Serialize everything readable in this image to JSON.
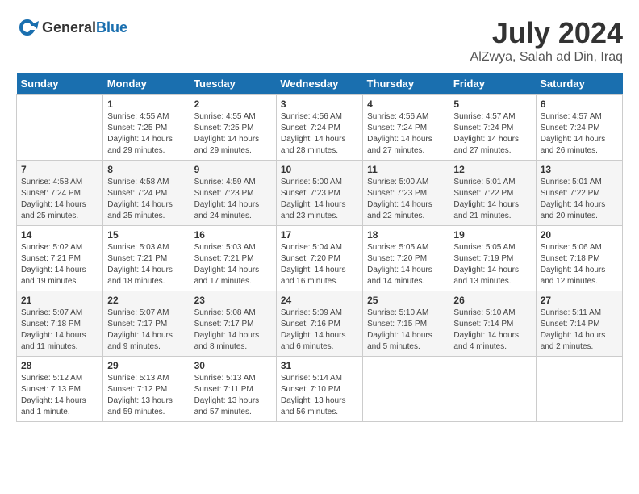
{
  "header": {
    "logo_general": "General",
    "logo_blue": "Blue",
    "title": "July 2024",
    "location": "AlZwya, Salah ad Din, Iraq"
  },
  "days_of_week": [
    "Sunday",
    "Monday",
    "Tuesday",
    "Wednesday",
    "Thursday",
    "Friday",
    "Saturday"
  ],
  "weeks": [
    [
      {
        "day": "",
        "content": ""
      },
      {
        "day": "1",
        "content": "Sunrise: 4:55 AM\nSunset: 7:25 PM\nDaylight: 14 hours\nand 29 minutes."
      },
      {
        "day": "2",
        "content": "Sunrise: 4:55 AM\nSunset: 7:25 PM\nDaylight: 14 hours\nand 29 minutes."
      },
      {
        "day": "3",
        "content": "Sunrise: 4:56 AM\nSunset: 7:24 PM\nDaylight: 14 hours\nand 28 minutes."
      },
      {
        "day": "4",
        "content": "Sunrise: 4:56 AM\nSunset: 7:24 PM\nDaylight: 14 hours\nand 27 minutes."
      },
      {
        "day": "5",
        "content": "Sunrise: 4:57 AM\nSunset: 7:24 PM\nDaylight: 14 hours\nand 27 minutes."
      },
      {
        "day": "6",
        "content": "Sunrise: 4:57 AM\nSunset: 7:24 PM\nDaylight: 14 hours\nand 26 minutes."
      }
    ],
    [
      {
        "day": "7",
        "content": "Sunrise: 4:58 AM\nSunset: 7:24 PM\nDaylight: 14 hours\nand 25 minutes."
      },
      {
        "day": "8",
        "content": "Sunrise: 4:58 AM\nSunset: 7:24 PM\nDaylight: 14 hours\nand 25 minutes."
      },
      {
        "day": "9",
        "content": "Sunrise: 4:59 AM\nSunset: 7:23 PM\nDaylight: 14 hours\nand 24 minutes."
      },
      {
        "day": "10",
        "content": "Sunrise: 5:00 AM\nSunset: 7:23 PM\nDaylight: 14 hours\nand 23 minutes."
      },
      {
        "day": "11",
        "content": "Sunrise: 5:00 AM\nSunset: 7:23 PM\nDaylight: 14 hours\nand 22 minutes."
      },
      {
        "day": "12",
        "content": "Sunrise: 5:01 AM\nSunset: 7:22 PM\nDaylight: 14 hours\nand 21 minutes."
      },
      {
        "day": "13",
        "content": "Sunrise: 5:01 AM\nSunset: 7:22 PM\nDaylight: 14 hours\nand 20 minutes."
      }
    ],
    [
      {
        "day": "14",
        "content": "Sunrise: 5:02 AM\nSunset: 7:21 PM\nDaylight: 14 hours\nand 19 minutes."
      },
      {
        "day": "15",
        "content": "Sunrise: 5:03 AM\nSunset: 7:21 PM\nDaylight: 14 hours\nand 18 minutes."
      },
      {
        "day": "16",
        "content": "Sunrise: 5:03 AM\nSunset: 7:21 PM\nDaylight: 14 hours\nand 17 minutes."
      },
      {
        "day": "17",
        "content": "Sunrise: 5:04 AM\nSunset: 7:20 PM\nDaylight: 14 hours\nand 16 minutes."
      },
      {
        "day": "18",
        "content": "Sunrise: 5:05 AM\nSunset: 7:20 PM\nDaylight: 14 hours\nand 14 minutes."
      },
      {
        "day": "19",
        "content": "Sunrise: 5:05 AM\nSunset: 7:19 PM\nDaylight: 14 hours\nand 13 minutes."
      },
      {
        "day": "20",
        "content": "Sunrise: 5:06 AM\nSunset: 7:18 PM\nDaylight: 14 hours\nand 12 minutes."
      }
    ],
    [
      {
        "day": "21",
        "content": "Sunrise: 5:07 AM\nSunset: 7:18 PM\nDaylight: 14 hours\nand 11 minutes."
      },
      {
        "day": "22",
        "content": "Sunrise: 5:07 AM\nSunset: 7:17 PM\nDaylight: 14 hours\nand 9 minutes."
      },
      {
        "day": "23",
        "content": "Sunrise: 5:08 AM\nSunset: 7:17 PM\nDaylight: 14 hours\nand 8 minutes."
      },
      {
        "day": "24",
        "content": "Sunrise: 5:09 AM\nSunset: 7:16 PM\nDaylight: 14 hours\nand 6 minutes."
      },
      {
        "day": "25",
        "content": "Sunrise: 5:10 AM\nSunset: 7:15 PM\nDaylight: 14 hours\nand 5 minutes."
      },
      {
        "day": "26",
        "content": "Sunrise: 5:10 AM\nSunset: 7:14 PM\nDaylight: 14 hours\nand 4 minutes."
      },
      {
        "day": "27",
        "content": "Sunrise: 5:11 AM\nSunset: 7:14 PM\nDaylight: 14 hours\nand 2 minutes."
      }
    ],
    [
      {
        "day": "28",
        "content": "Sunrise: 5:12 AM\nSunset: 7:13 PM\nDaylight: 14 hours\nand 1 minute."
      },
      {
        "day": "29",
        "content": "Sunrise: 5:13 AM\nSunset: 7:12 PM\nDaylight: 13 hours\nand 59 minutes."
      },
      {
        "day": "30",
        "content": "Sunrise: 5:13 AM\nSunset: 7:11 PM\nDaylight: 13 hours\nand 57 minutes."
      },
      {
        "day": "31",
        "content": "Sunrise: 5:14 AM\nSunset: 7:10 PM\nDaylight: 13 hours\nand 56 minutes."
      },
      {
        "day": "",
        "content": ""
      },
      {
        "day": "",
        "content": ""
      },
      {
        "day": "",
        "content": ""
      }
    ]
  ]
}
